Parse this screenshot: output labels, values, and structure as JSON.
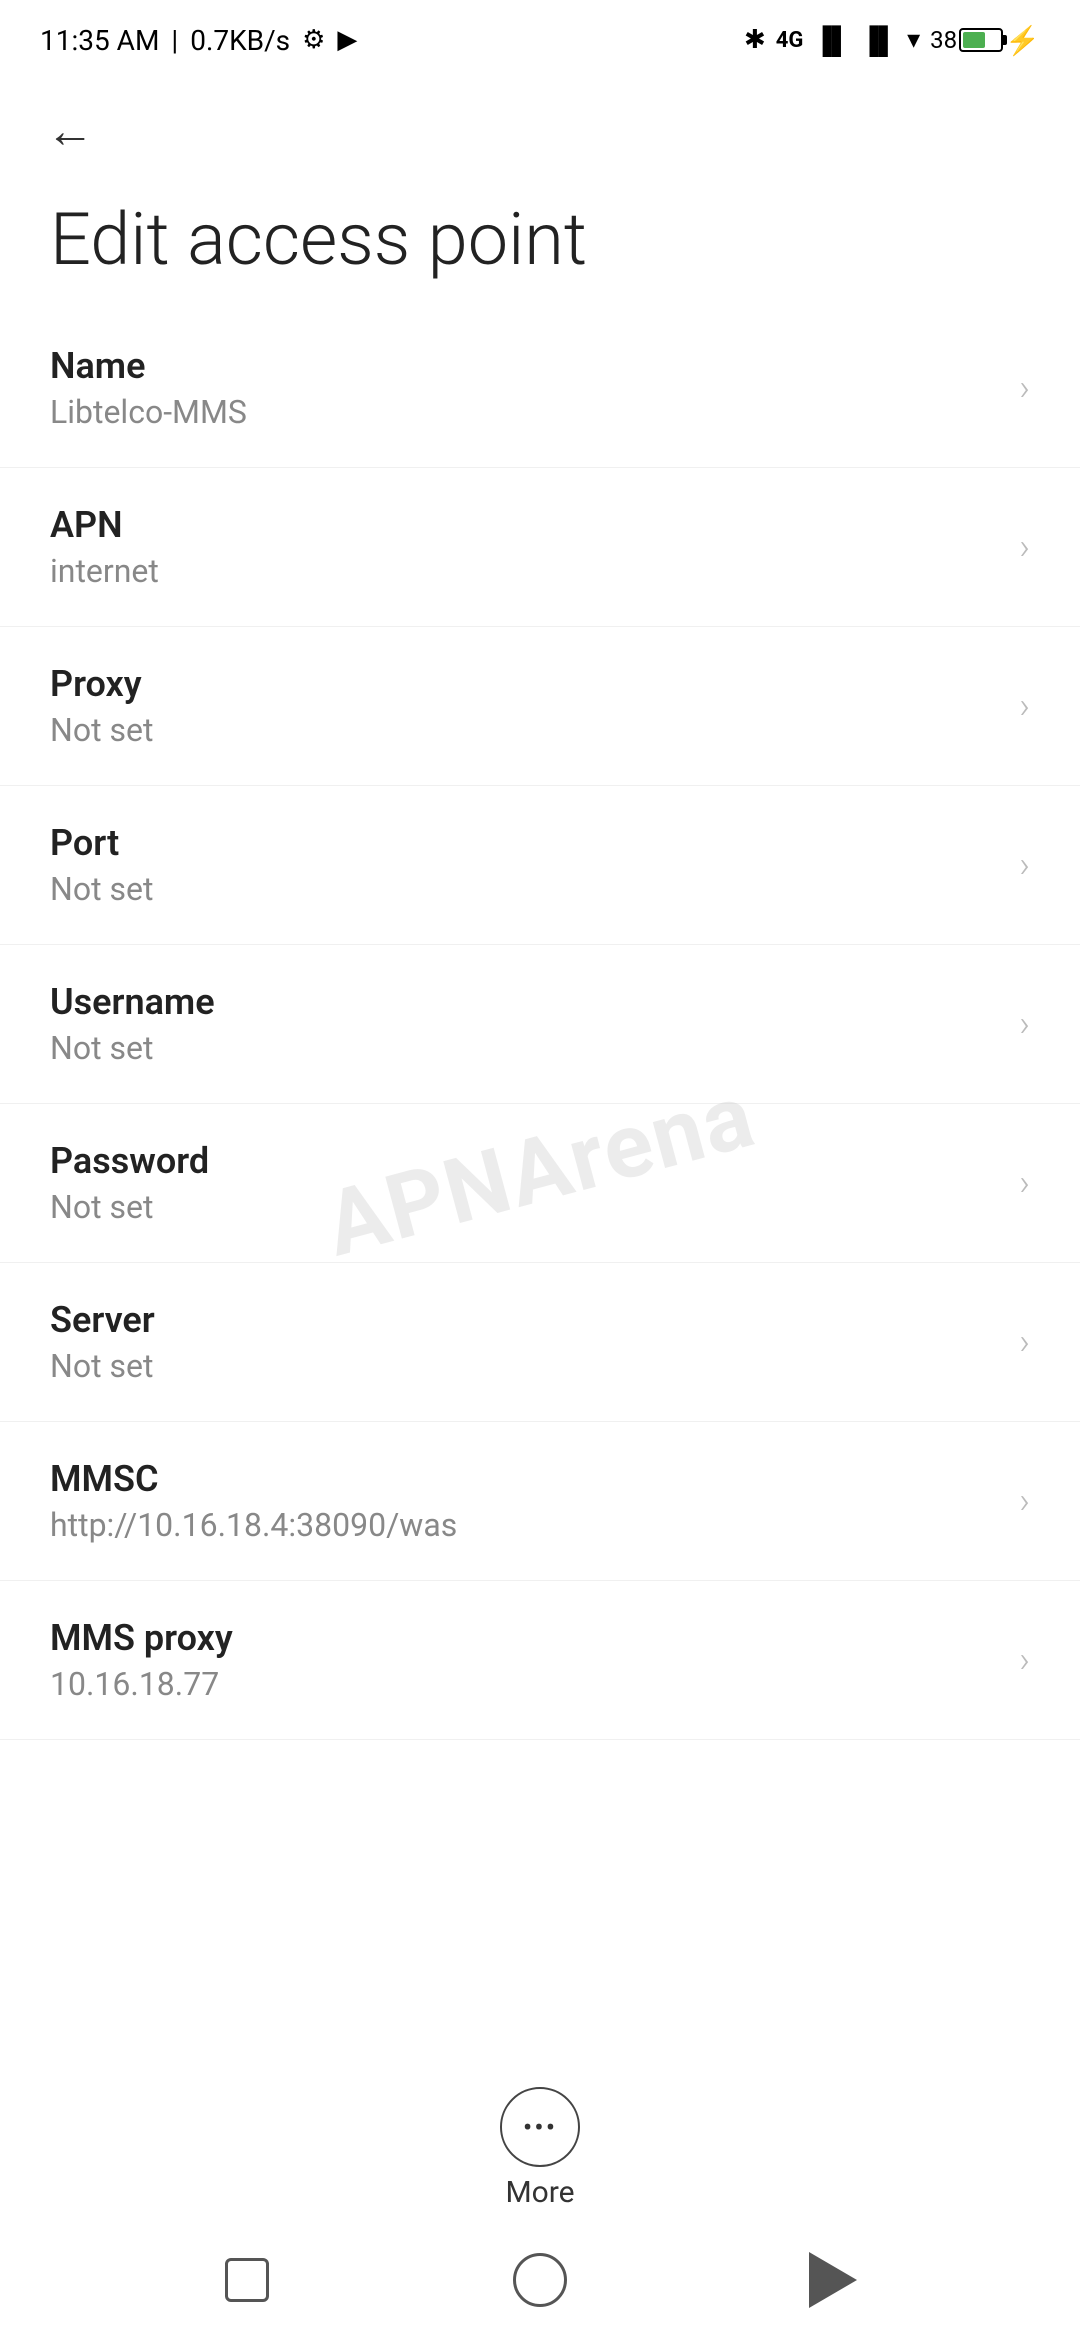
{
  "statusBar": {
    "time": "11:35 AM",
    "speed": "0.7KB/s",
    "batteryPercent": "38"
  },
  "nav": {
    "backLabel": "←"
  },
  "page": {
    "title": "Edit access point"
  },
  "settingsItems": [
    {
      "label": "Name",
      "value": "Libtelco-MMS"
    },
    {
      "label": "APN",
      "value": "internet"
    },
    {
      "label": "Proxy",
      "value": "Not set"
    },
    {
      "label": "Port",
      "value": "Not set"
    },
    {
      "label": "Username",
      "value": "Not set"
    },
    {
      "label": "Password",
      "value": "Not set"
    },
    {
      "label": "Server",
      "value": "Not set"
    },
    {
      "label": "MMSC",
      "value": "http://10.16.18.4:38090/was"
    },
    {
      "label": "MMS proxy",
      "value": "10.16.18.77"
    }
  ],
  "more": {
    "label": "More"
  },
  "watermark": {
    "text": "APNArena"
  }
}
